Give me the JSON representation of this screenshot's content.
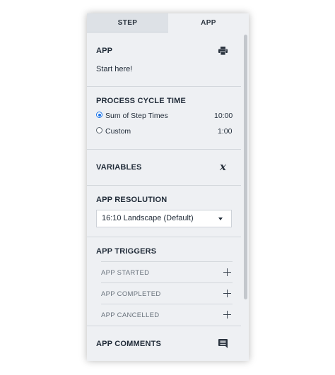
{
  "tabs": [
    {
      "label": "STEP",
      "active": false
    },
    {
      "label": "APP",
      "active": true
    }
  ],
  "app_section": {
    "title": "APP",
    "name": "Start here!",
    "icon": "print-icon"
  },
  "cycle_time": {
    "title": "PROCESS CYCLE TIME",
    "options": [
      {
        "label": "Sum of Step Times",
        "value": "10:00",
        "selected": true
      },
      {
        "label": "Custom",
        "value": "1:00",
        "selected": false
      }
    ]
  },
  "variables": {
    "title": "VARIABLES",
    "icon": "variable-x-icon",
    "glyph": "x"
  },
  "resolution": {
    "title": "APP RESOLUTION",
    "selected": "16:10 Landscape (Default)"
  },
  "triggers": {
    "title": "APP TRIGGERS",
    "items": [
      {
        "label": "APP STARTED"
      },
      {
        "label": "APP COMPLETED"
      },
      {
        "label": "APP CANCELLED"
      }
    ]
  },
  "comments": {
    "title": "APP COMMENTS",
    "icon": "comment-icon"
  },
  "colors": {
    "panel_bg": "#eef0f3",
    "inactive_tab_bg": "#dde1e6",
    "accent": "#1a73e8",
    "scrollbar": "#c3c7cc"
  }
}
